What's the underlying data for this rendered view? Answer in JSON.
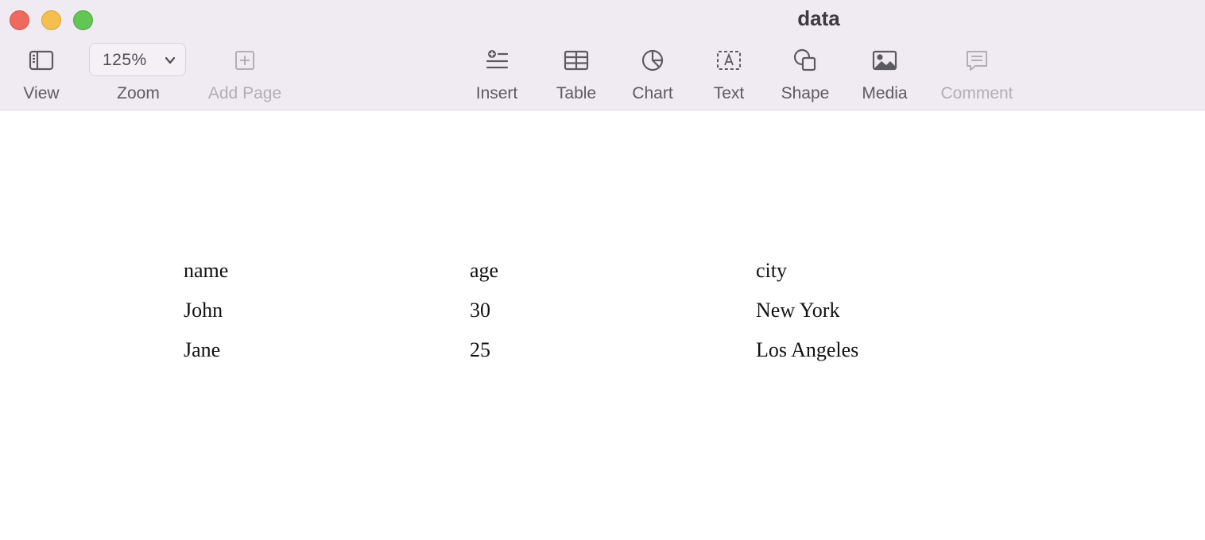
{
  "window": {
    "title": "data"
  },
  "toolbar": {
    "view": {
      "label": "View",
      "icon": "sidebar-icon"
    },
    "zoom": {
      "label": "Zoom",
      "value": "125%",
      "icon": "chevron-down-icon"
    },
    "add_page": {
      "label": "Add Page",
      "icon": "plus-square-icon",
      "disabled": true
    },
    "insert": {
      "label": "Insert",
      "icon": "insert-list-icon"
    },
    "table": {
      "label": "Table",
      "icon": "table-icon"
    },
    "chart": {
      "label": "Chart",
      "icon": "pie-chart-icon"
    },
    "text": {
      "label": "Text",
      "icon": "text-box-icon"
    },
    "shape": {
      "label": "Shape",
      "icon": "shapes-icon"
    },
    "media": {
      "label": "Media",
      "icon": "photo-icon"
    },
    "comment": {
      "label": "Comment",
      "icon": "comment-icon",
      "disabled": true
    }
  },
  "document": {
    "table": {
      "headers": [
        "name",
        "age",
        "city"
      ],
      "rows": [
        [
          "John",
          "30",
          "New York"
        ],
        [
          "Jane",
          "25",
          "Los Angeles"
        ]
      ]
    }
  },
  "colors": {
    "toolbar_bg": "#f0ebf3",
    "close": "#ed6a5e",
    "minimize": "#f5bf4f",
    "maximize": "#62c554",
    "icon": "#5d5a61",
    "disabled": "#b2aeb5"
  }
}
